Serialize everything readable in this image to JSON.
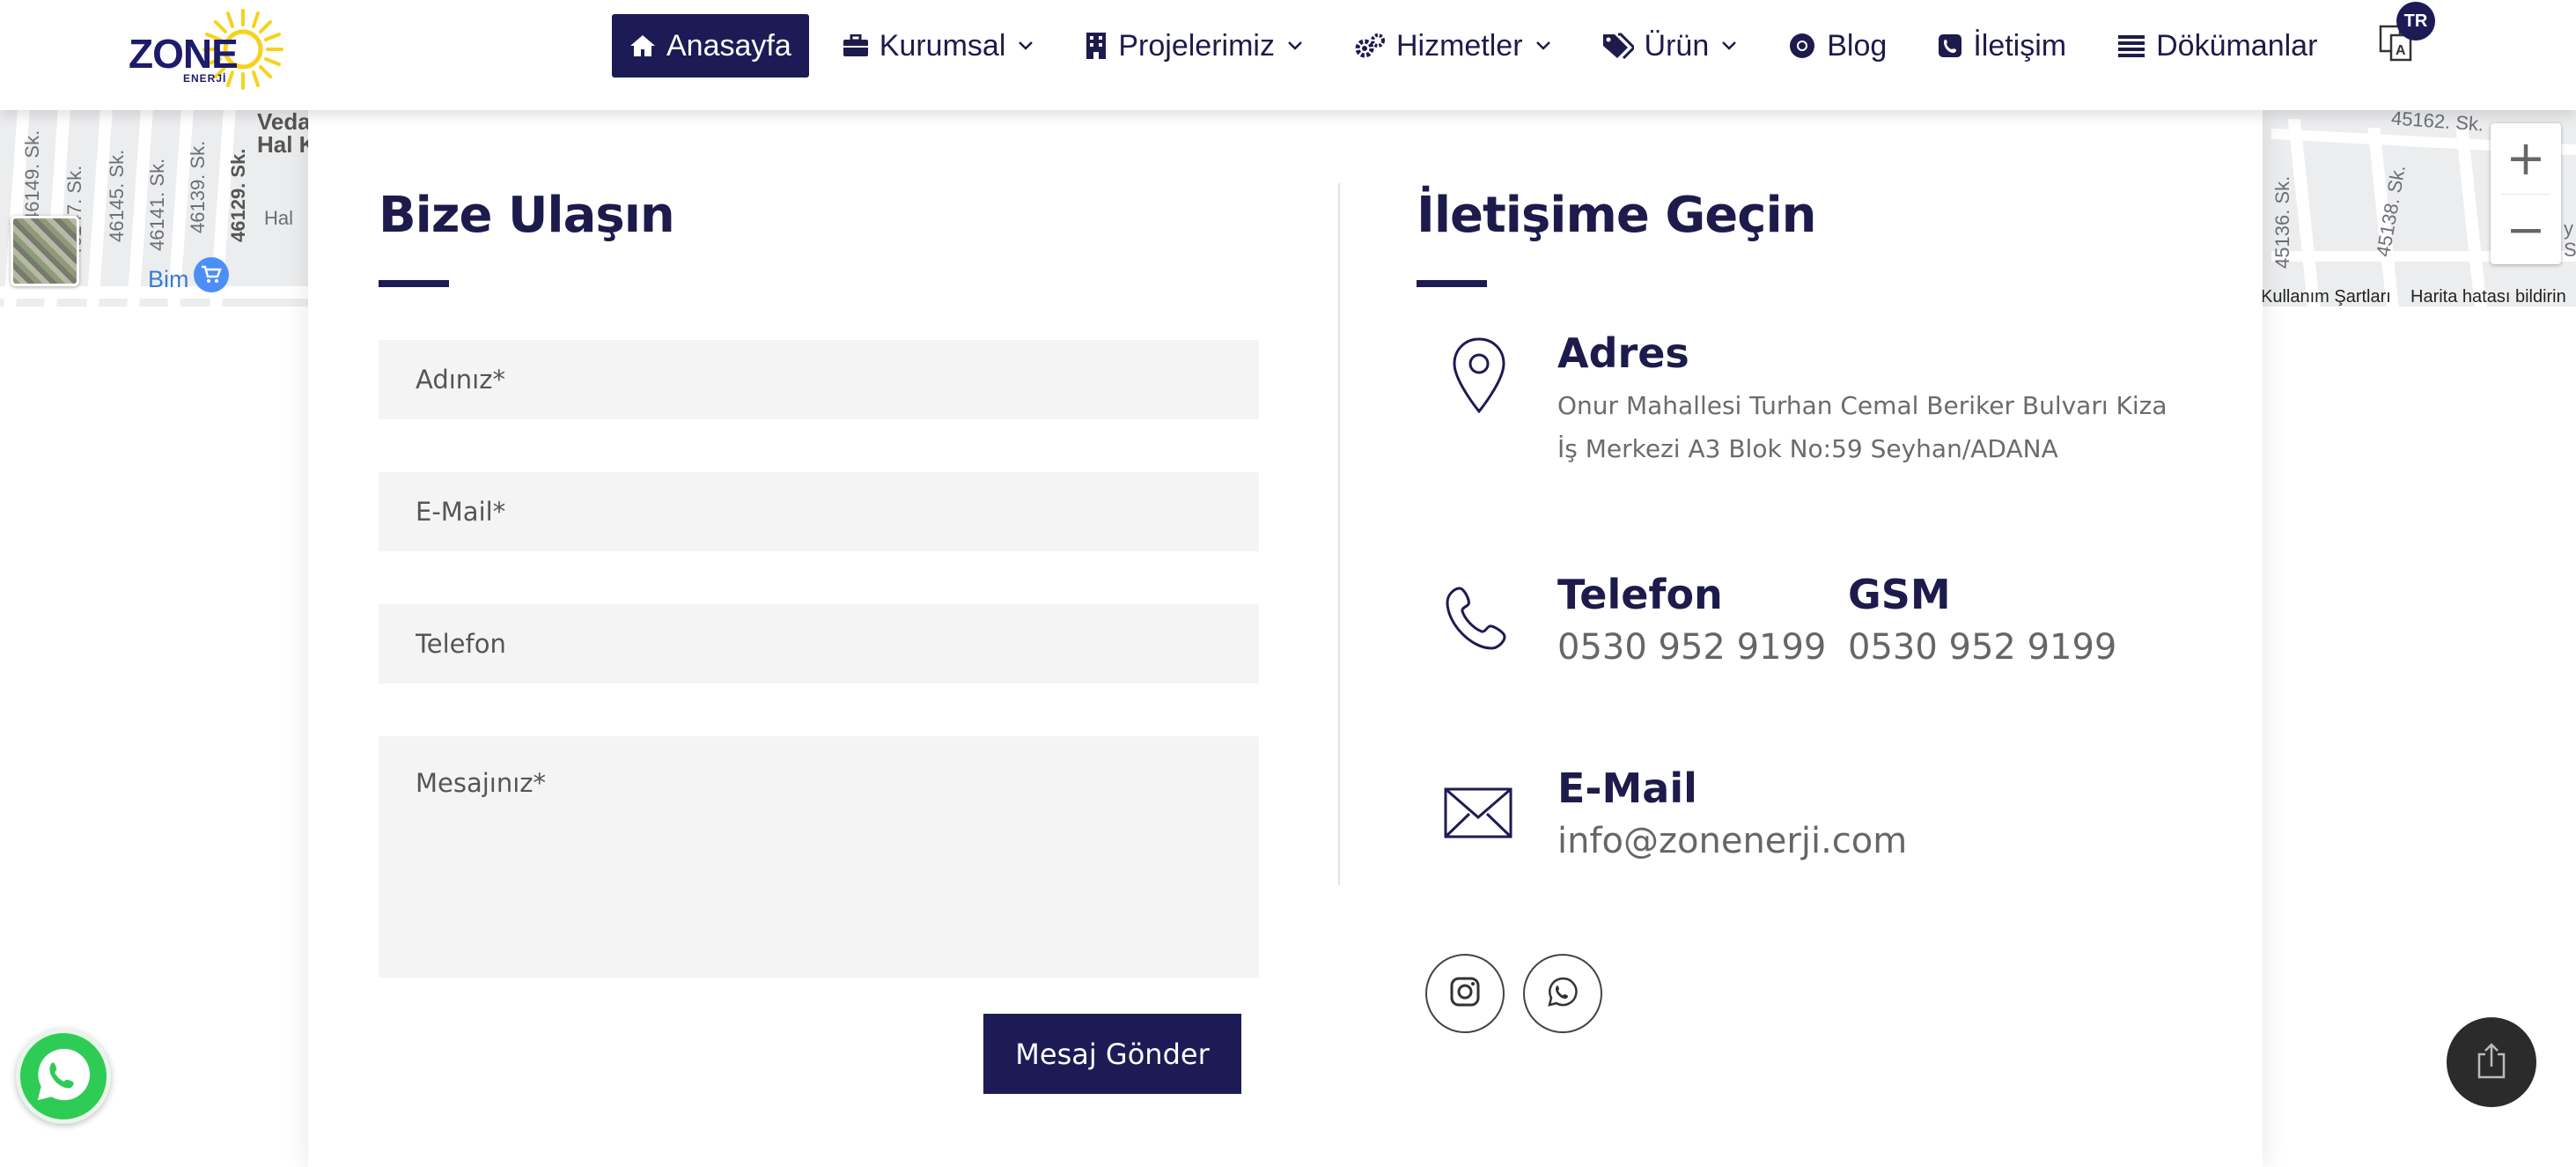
{
  "header": {
    "logo": {
      "name": "ZONE",
      "sub": "ENERJİ"
    },
    "nav": [
      {
        "label": "Anasayfa",
        "icon": "home-icon",
        "dropdown": false,
        "active": true
      },
      {
        "label": "Kurumsal",
        "icon": "briefcase-icon",
        "dropdown": true,
        "active": false
      },
      {
        "label": "Projelerimiz",
        "icon": "building-icon",
        "dropdown": true,
        "active": false
      },
      {
        "label": "Hizmetler",
        "icon": "gears-icon",
        "dropdown": true,
        "active": false
      },
      {
        "label": "Ürün",
        "icon": "tags-icon",
        "dropdown": true,
        "active": false
      },
      {
        "label": "Blog",
        "icon": "chrome-icon",
        "dropdown": false,
        "active": false
      },
      {
        "label": "İletişim",
        "icon": "phone-square-icon",
        "dropdown": false,
        "active": false
      },
      {
        "label": "Dökümanlar",
        "icon": "list-icon",
        "dropdown": false,
        "active": false
      }
    ],
    "language": {
      "code": "TR",
      "icon": "translate-icon"
    }
  },
  "map": {
    "street_labels": [
      "46149. Sk.",
      "46147. Sk.",
      "46145. Sk.",
      "46141. Sk.",
      "46139. Sk.",
      "46129. Sk."
    ],
    "place_labels": [
      "Veda",
      "Hal K",
      "Hal"
    ],
    "right_labels": [
      "45162. Sk.",
      "45136. Sk.",
      "45138. Sk.",
      "y",
      "S"
    ],
    "poi": "Bim",
    "terms": "Kullanım Şartları",
    "report": "Harita hatası bildirin",
    "zoom_in": "+",
    "zoom_out": "−"
  },
  "contact_form": {
    "title": "Bize Ulaşın",
    "name_placeholder": "Adınız*",
    "email_placeholder": "E-Mail*",
    "phone_placeholder": "Telefon",
    "message_placeholder": "Mesajınız*",
    "submit_label": "Mesaj Gönder"
  },
  "contact_info": {
    "title": "İletişime Geçin",
    "address": {
      "label": "Adres",
      "line1": "Onur Mahallesi Turhan Cemal Beriker Bulvarı Kiza",
      "line2": "İş Merkezi A3 Blok No:59 Seyhan/ADANA"
    },
    "phone": {
      "label": "Telefon",
      "value": "0530 952 9199"
    },
    "gsm": {
      "label": "GSM",
      "value": "0530 952 9199"
    },
    "email": {
      "label": "E-Mail",
      "value": "info@zonenerji.com"
    },
    "social": [
      "instagram-icon",
      "whatsapp-icon"
    ]
  },
  "colors": {
    "primary": "#1d1b55",
    "text": "#1d1b4c",
    "muted": "#6b6b6b",
    "field_bg": "#f4f4f4",
    "whatsapp": "#2ecc55"
  }
}
